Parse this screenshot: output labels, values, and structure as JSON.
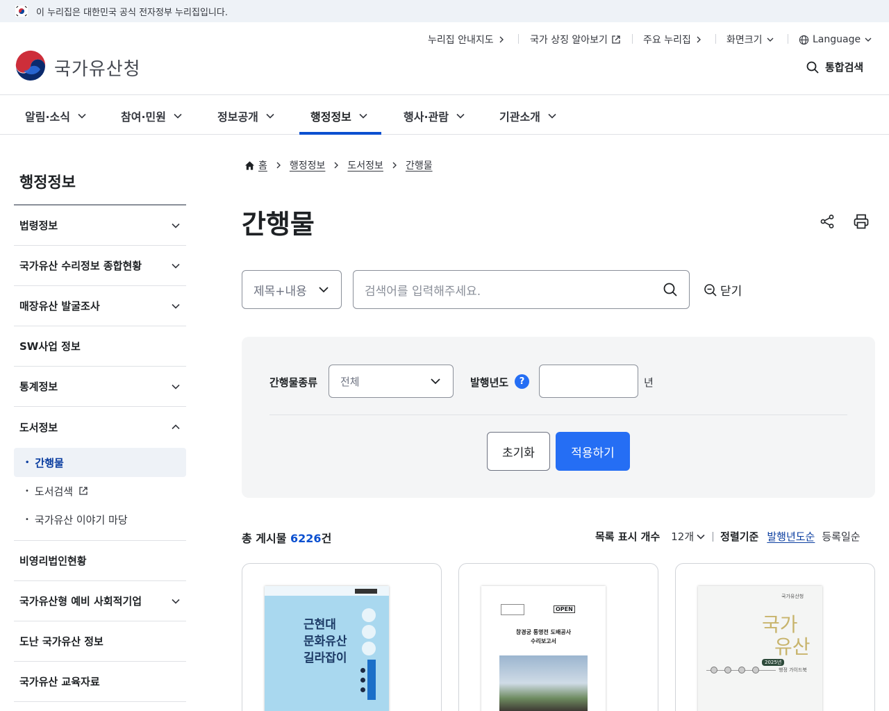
{
  "gov_banner": {
    "text": "이 누리집은 대한민국 공식 전자정부 누리집입니다."
  },
  "utility": {
    "sitemap": "누리집 안내지도",
    "symbols": "국가 상징 알아보기",
    "major_sites": "주요 누리집",
    "zoom": "화면크기",
    "language": "Language"
  },
  "header": {
    "org_name": "국가유산청",
    "search_label": "통합검색"
  },
  "gnb": {
    "items": [
      "알림·소식",
      "참여·민원",
      "정보공개",
      "행정정보",
      "행사·관람",
      "기관소개"
    ],
    "active": "행정정보"
  },
  "sidebar": {
    "title": "행정정보",
    "items": [
      "법령정보",
      "국가유산 수리정보 종합현황",
      "매장유산 발굴조사",
      "SW사업 정보",
      "통계정보",
      "도서정보",
      "비영리법인현황",
      "국가유산형 예비 사회적기업",
      "도난 국가유산 정보",
      "국가유산 교육자료"
    ],
    "sub_items": [
      "간행물",
      "도서검색",
      "국가유산 이야기 마당"
    ]
  },
  "breadcrumb": [
    "홈",
    "행정정보",
    "도서정보",
    "간행물"
  ],
  "page_title": "간행물",
  "search": {
    "scope": "제목+내용",
    "placeholder": "검색어를 입력해주세요.",
    "close_label": "닫기"
  },
  "filter": {
    "type_label": "간행물종류",
    "type_value": "전체",
    "year_label": "발행년도",
    "help": "?",
    "year_value": "",
    "year_unit": "년",
    "reset": "초기화",
    "apply": "적용하기"
  },
  "list": {
    "total_prefix": "총 게시물 ",
    "total_count": "6226",
    "total_suffix": "건",
    "per_page_label": "목록 표시 개수",
    "per_page_value": "12개",
    "sort_label": "정렬기준",
    "sort_options": [
      "발행년도순",
      "등록일순"
    ]
  },
  "cards": [
    {
      "cover_title": [
        "근현대",
        "문화유산",
        "길라잡이"
      ],
      "cover_color": "#a9d8ef"
    },
    {
      "cover_title": [
        "창경궁 통명전 도배공사",
        "수리보고서"
      ],
      "badge": "OPEN"
    },
    {
      "cover_title": [
        "국가",
        "유산"
      ],
      "cover_sub": "행정 가이드북",
      "cover_year": "2025년",
      "cover_top": "국가유산청"
    }
  ],
  "colors": {
    "primary": "#256ef4",
    "active_nav": "#0b50d0",
    "panel": "#f4f5f6"
  }
}
